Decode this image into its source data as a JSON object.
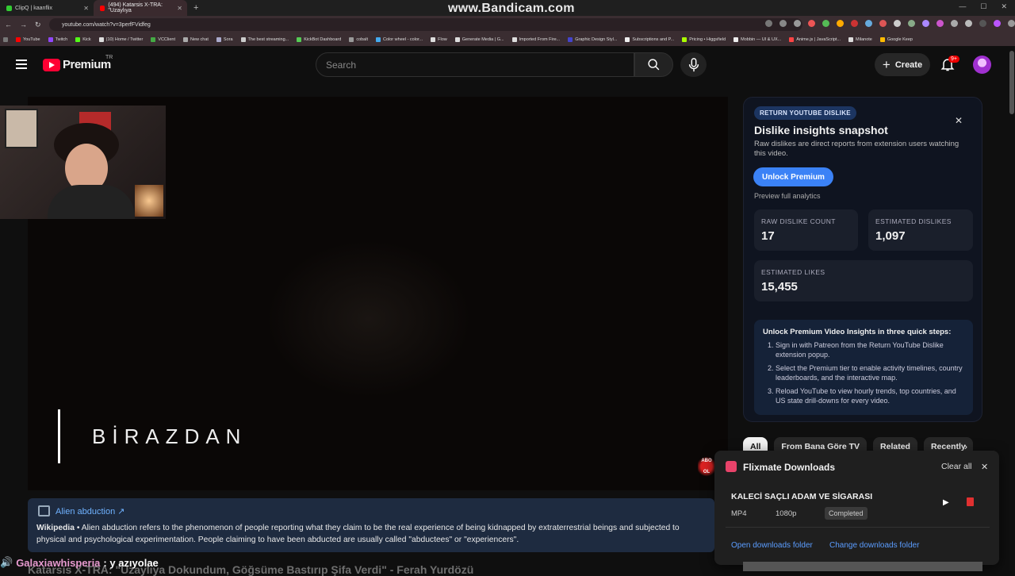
{
  "browser": {
    "tabs": [
      {
        "label": "ClipQ | kaanflix",
        "active": false
      },
      {
        "label": "(494) Katarsis X-TRA: \"Uzaylıya",
        "active": true
      }
    ],
    "url": "youtube.com/watch?v=3perfFVidfeg",
    "watermark": "www.Bandicam.com",
    "bookmarks": [
      "YouTube",
      "Twitch",
      "Kick",
      "(10) Home / Twitter",
      "VCClient",
      "New chat",
      "Sora",
      "The best streaming...",
      "KickBot Dashboard",
      "cobalt",
      "Color wheel - color...",
      "Flow",
      "Generate Media | G...",
      "Imported From Fire...",
      "Graphic Design Styl...",
      "Subscriptions and P...",
      "Pricing • Higgsfield",
      "Mobbin — UI & UX...",
      "Anime.js | JavaScript...",
      "Milanote",
      "Google Keep"
    ]
  },
  "header": {
    "logo_text": "Premium",
    "logo_region": "TR",
    "search_placeholder": "Search",
    "create_label": "Create",
    "notification_count": "9+"
  },
  "player": {
    "overlay_text": "BİRAZDAN"
  },
  "dislike_panel": {
    "badge": "RETURN YOUTUBE DISLIKE",
    "title": "Dislike insights snapshot",
    "subtitle": "Raw dislikes are direct reports from extension users watching this video.",
    "unlock_label": "Unlock Premium",
    "preview_label": "Preview full analytics",
    "stats": [
      {
        "label": "RAW DISLIKE COUNT",
        "value": "17"
      },
      {
        "label": "ESTIMATED DISLIKES",
        "value": "1,097"
      },
      {
        "label": "ESTIMATED LIKES",
        "value": "15,455"
      }
    ],
    "steps_title": "Unlock Premium Video Insights in three quick steps:",
    "steps": [
      "Sign in with Patreon from the Return YouTube Dislike extension popup.",
      "Select the Premium tier to enable activity timelines, country leaderboards, and the interactive map.",
      "Reload YouTube to view hourly trends, top countries, and US state drill-downs for every video."
    ]
  },
  "chips": [
    "All",
    "From Bana Göre TV",
    "Related",
    "Recently"
  ],
  "flixmate": {
    "title": "Flixmate Downloads",
    "clear_all": "Clear all",
    "file_name": "KALECİ SAÇLI ADAM VE SİGARASI",
    "format": "MP4",
    "resolution": "1080p",
    "status": "Completed",
    "open_folder": "Open downloads folder",
    "change_folder": "Change downloads folder"
  },
  "wiki": {
    "heading": "Alien abduction ↗",
    "source": "Wikipedia",
    "text": " • Alien abduction refers to the phenomenon of people reporting what they claim to be the real experience of being kidnapped by extraterrestrial beings and subjected to physical and psychological experimentation. People claiming to have been abducted are usually called \"abductees\" or \"experiencers\"."
  },
  "chat": {
    "user": "Galaxiawhisperia",
    "message": ": y azıyolae"
  },
  "video_title": "Katarsis X-TRA: \"Uzaylıya Dokundum, Göğsüme Bastırıp Şifa Verdi\" - Ferah Yurdözü",
  "colors": {
    "accent": "#3b82f6",
    "yt_red": "#ff0033",
    "link": "#5b9dff"
  }
}
